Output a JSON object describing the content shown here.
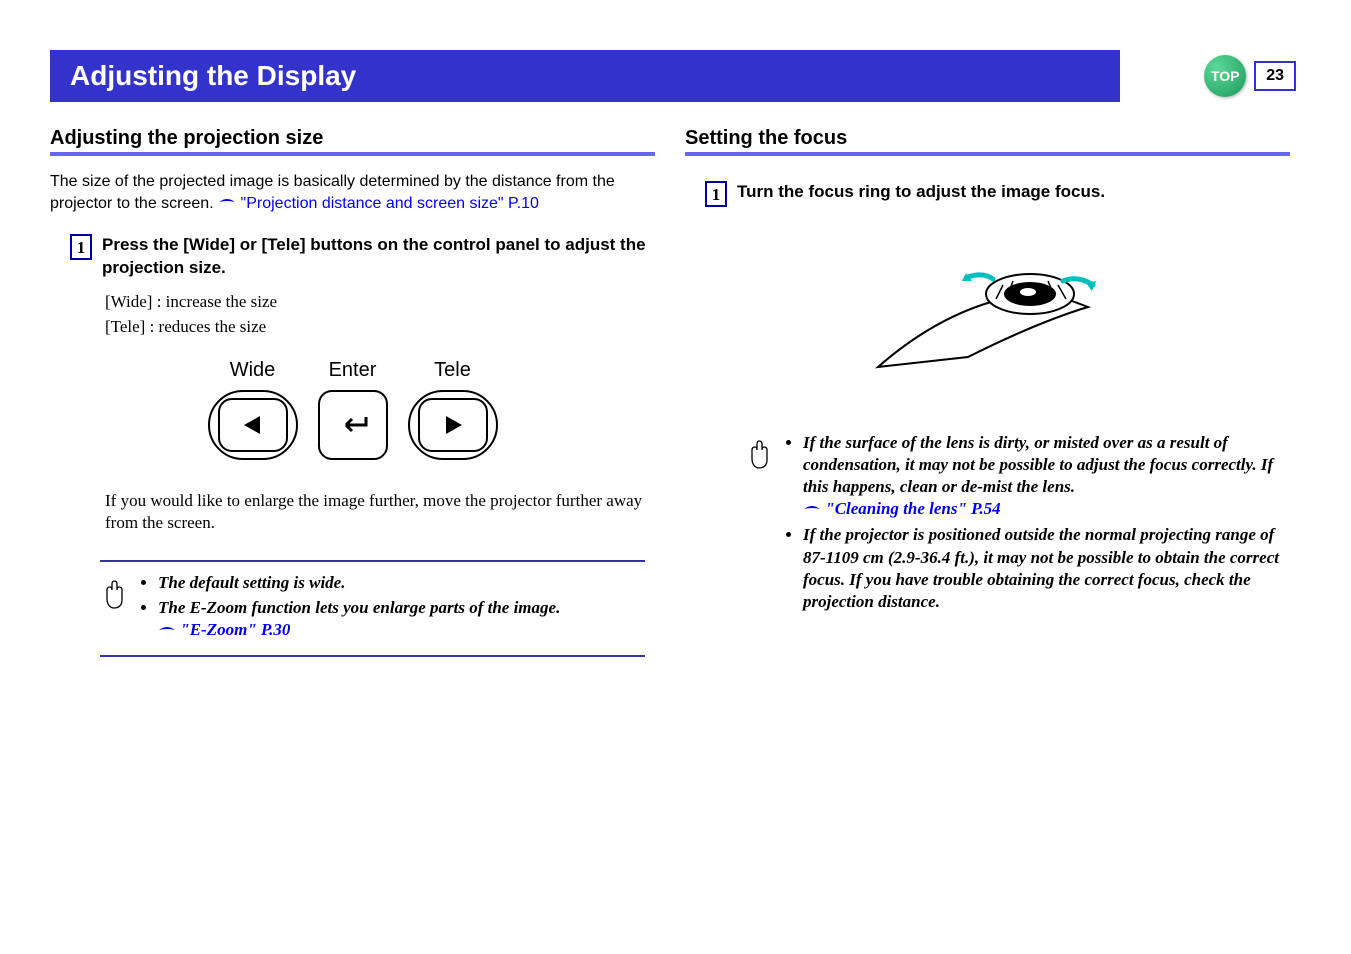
{
  "page_number": "23",
  "top_label": "TOP",
  "title": "Adjusting the Display",
  "left": {
    "heading": "Adjusting the projection size",
    "intro_pre": "The size of the projected image is basically determined by the distance from the projector to the screen. ",
    "intro_link": "\"Projection distance and screen size\" P.10",
    "step_num": "1",
    "step_text": "Press the [Wide] or [Tele] buttons on the control panel to adjust the projection size.",
    "def_wide": "[Wide] : increase the size",
    "def_tele": "[Tele] :   reduces the size",
    "btn_wide": "Wide",
    "btn_enter": "Enter",
    "btn_tele": "Tele",
    "followup": "If you would like to enlarge the image further, move the projector further away from the screen.",
    "tip1": "The default setting is wide.",
    "tip2": "The E-Zoom function lets you enlarge parts of the image.",
    "tip2_link": "\"E-Zoom\" P.30"
  },
  "right": {
    "heading": "Setting the focus",
    "step_num": "1",
    "step_text": "Turn the focus ring to adjust the image focus.",
    "tip1": "If the surface of the lens is dirty, or misted over as a result of condensation, it may not be possible to adjust the focus correctly. If this happens, clean or de-mist the lens.",
    "tip1_link": "\"Cleaning the lens\" P.54",
    "tip2": "If the projector is positioned outside the normal projecting range of 87-1109 cm (2.9-36.4 ft.), it may not be possible to obtain the correct focus. If you have trouble obtaining the correct focus, check the projection distance."
  }
}
